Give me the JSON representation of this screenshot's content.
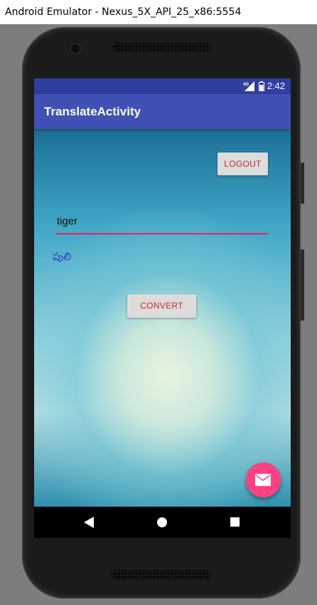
{
  "window": {
    "title": "Android Emulator - Nexus_5X_API_25_x86:5554"
  },
  "status_bar": {
    "time": "2:42",
    "network_label": "4G",
    "icons": [
      "signal-icon",
      "battery-icon"
    ]
  },
  "app_bar": {
    "title": "TranslateActivity"
  },
  "main": {
    "logout_label": "LOGOUT",
    "input_value": "tiger",
    "translation": "పులి",
    "convert_label": "CONVERT"
  },
  "fab": {
    "icon": "email-icon"
  },
  "navigation": {
    "icons": [
      "back-icon",
      "home-icon",
      "recents-icon"
    ]
  },
  "colors": {
    "status_bar": "#303f9f",
    "app_bar": "#3f51b5",
    "accent": "#ff4081",
    "input_underline": "#e91e63",
    "button_text": "#c62828",
    "translation_text": "#2a3fbf"
  }
}
